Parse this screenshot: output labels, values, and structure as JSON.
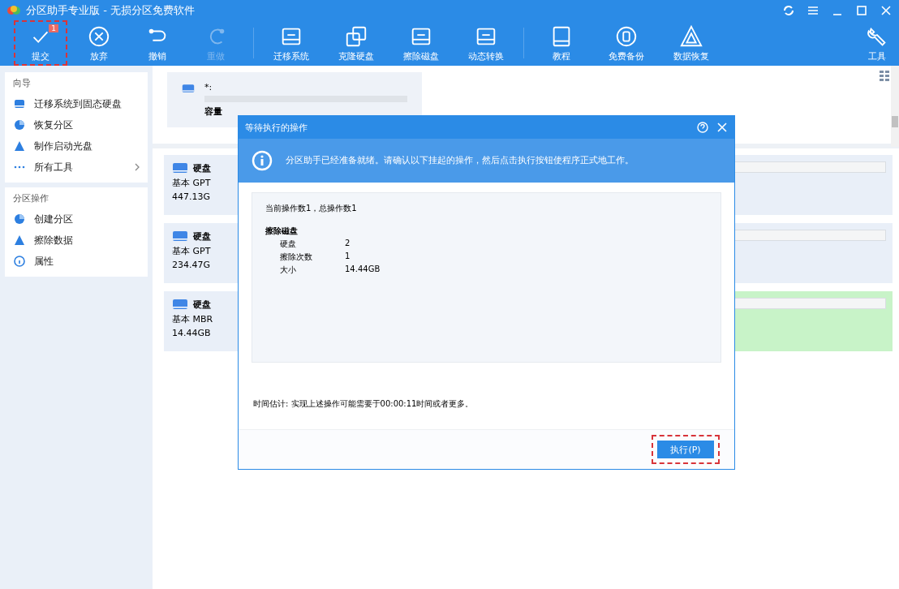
{
  "window": {
    "title": "分区助手专业版 - 无损分区免费软件"
  },
  "toolbar": [
    {
      "label": "提交",
      "kind": "check",
      "disabled": false,
      "highlighted": true,
      "badge": "1"
    },
    {
      "label": "放弃",
      "kind": "cancel",
      "disabled": false,
      "highlighted": false
    },
    {
      "label": "撤销",
      "kind": "undo",
      "disabled": false,
      "highlighted": false
    },
    {
      "label": "重做",
      "kind": "redo",
      "disabled": true,
      "highlighted": false
    },
    {
      "label": "迁移系统",
      "kind": "disk",
      "disabled": false,
      "highlighted": false
    },
    {
      "label": "克隆硬盘",
      "kind": "clone",
      "disabled": false,
      "highlighted": false
    },
    {
      "label": "擦除磁盘",
      "kind": "disk",
      "disabled": false,
      "highlighted": false
    },
    {
      "label": "动态转换",
      "kind": "disk",
      "disabled": false,
      "highlighted": false
    },
    {
      "label": "教程",
      "kind": "book",
      "disabled": false,
      "highlighted": false
    },
    {
      "label": "免费备份",
      "kind": "backup",
      "disabled": false,
      "highlighted": false
    },
    {
      "label": "数据恢复",
      "kind": "triangle",
      "disabled": false,
      "highlighted": false
    }
  ],
  "tools_button": {
    "label": "工具"
  },
  "sidebar": [
    {
      "title": "向导",
      "items": [
        {
          "label": "迁移系统到固态硬盘",
          "kind": "disk",
          "arrow": false
        },
        {
          "label": "恢复分区",
          "kind": "pie",
          "arrow": false
        },
        {
          "label": "制作启动光盘",
          "kind": "triangle",
          "arrow": false
        },
        {
          "label": "所有工具",
          "kind": "dots",
          "arrow": true
        }
      ]
    },
    {
      "title": "分区操作",
      "items": [
        {
          "label": "创建分区",
          "kind": "pie",
          "arrow": false
        },
        {
          "label": "擦除数据",
          "kind": "triangle",
          "arrow": false
        },
        {
          "label": "属性",
          "kind": "info",
          "arrow": false
        }
      ]
    }
  ],
  "partition_card": {
    "name": "*:",
    "capacity": "容量"
  },
  "disks": [
    {
      "name": "硬盘",
      "type": "基本 GPT",
      "size": "447.13G",
      "selected": false
    },
    {
      "name": "硬盘",
      "type": "基本 GPT",
      "size": "234.47G",
      "selected": false
    },
    {
      "name": "硬盘",
      "type": "基本 MBR",
      "size": "14.44GB",
      "selected": true
    }
  ],
  "dialog": {
    "title": "等待执行的操作",
    "info": "分区助手已经准备就绪。请确认以下挂起的操作，然后点击执行按钮使程序正式地工作。",
    "summary": "当前操作数1，总操作数1",
    "operation": {
      "title": "擦除磁盘",
      "rows": [
        {
          "label": "硬盘",
          "value": "2"
        },
        {
          "label": "擦除次数",
          "value": "1"
        },
        {
          "label": "大小",
          "value": "14.44GB"
        }
      ]
    },
    "estimate": "时间估计: 实现上述操作可能需要于00:00:11时间或者更多。",
    "button": {
      "label": "执行(P)",
      "highlighted": true
    }
  }
}
